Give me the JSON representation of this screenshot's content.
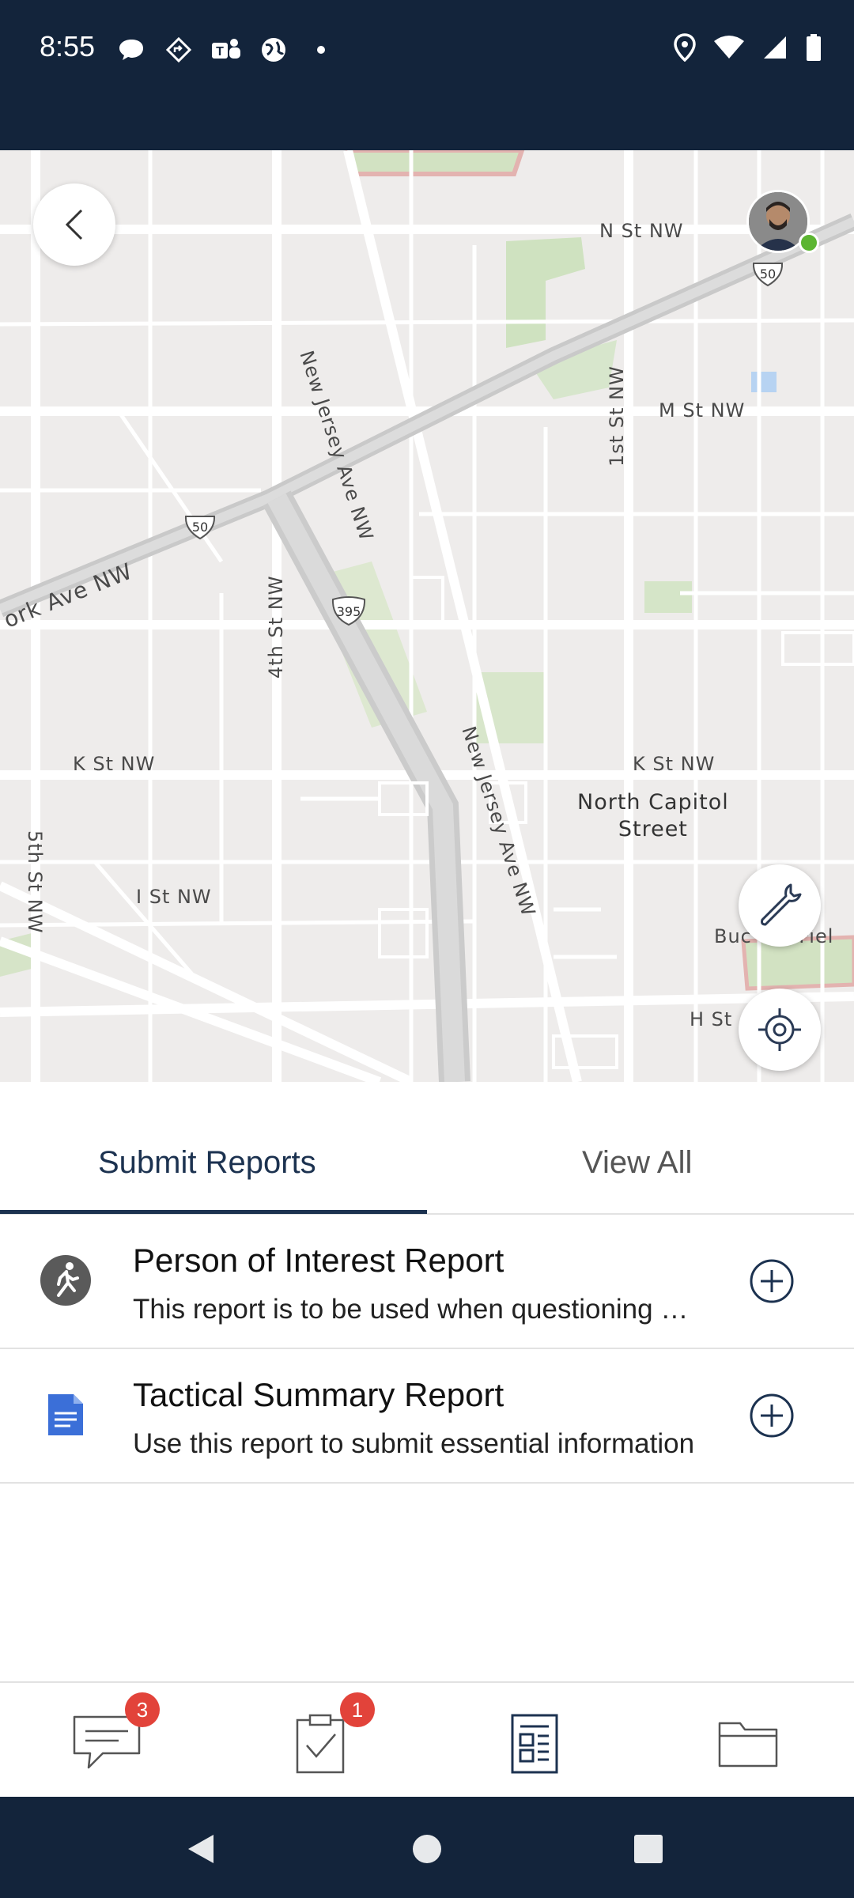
{
  "status_bar": {
    "time": "8:55",
    "left_icons": [
      "chat-bubble-icon",
      "diamond-nav-icon",
      "teams-icon",
      "globe-icon",
      "dot-icon"
    ],
    "right_icons": [
      "location-pin-icon",
      "wifi-icon",
      "signal-icon",
      "battery-icon"
    ]
  },
  "map": {
    "labels": {
      "n_st": "N St NW",
      "m_st": "M St NW",
      "new_jersey_top": "New Jersey Ave NW",
      "new_jersey_bottom": "New Jersey Ave NW",
      "first_st": "1st St NW",
      "fourth_st": "4th St NW",
      "york_ave": "ork Ave NW",
      "k_st_left": "K St NW",
      "k_st_right": "K St NW",
      "north_capitol_1": "North Capitol",
      "north_capitol_2": "Street",
      "fifth_st": "5th St NW",
      "i_st": "I St NW",
      "h_st": "H St",
      "buchanan": "Buc    n Fiel"
    },
    "shields": {
      "us50_top": "50",
      "us50_left": "50",
      "i395": "395"
    }
  },
  "tabs": {
    "submit": "Submit Reports",
    "view_all": "View All",
    "active": "submit"
  },
  "reports": [
    {
      "title": "Person of Interest Report",
      "description": "This report is to be used when questioning a person of interest",
      "icon": "walking-person-icon"
    },
    {
      "title": "Tactical Summary Report",
      "description": "Use this report to submit essential information",
      "icon": "document-icon"
    }
  ],
  "bottom_nav": {
    "messages_badge": "3",
    "tasks_badge": "1",
    "items": [
      "messages-icon",
      "tasks-icon",
      "reports-icon",
      "folder-icon"
    ],
    "active": "reports-icon"
  },
  "colors": {
    "header_bg": "#13243b",
    "accent": "#1c3250",
    "badge": "#e2433a",
    "online": "#5cb531",
    "doc_icon": "#3b6fd8"
  }
}
